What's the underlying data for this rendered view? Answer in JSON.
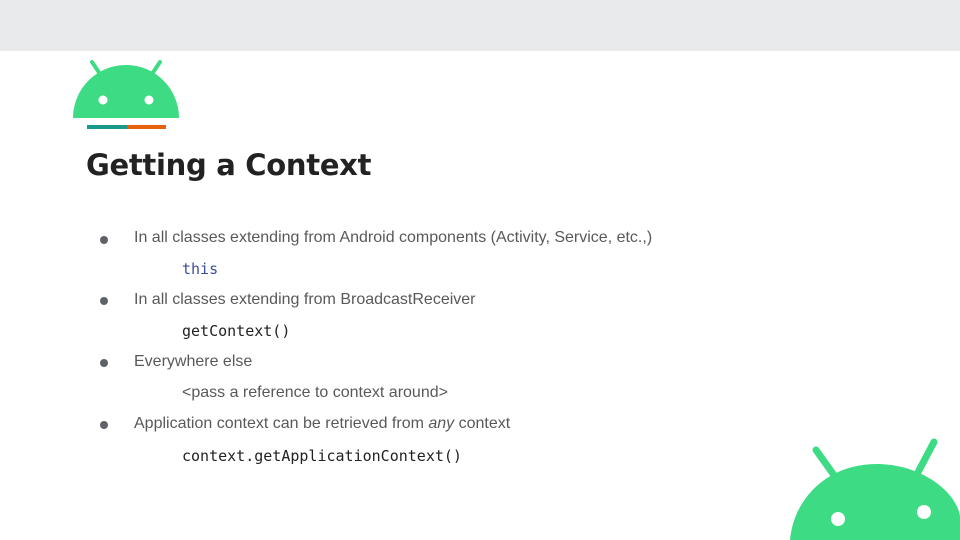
{
  "slide": {
    "title": "Getting a Context",
    "bullets": [
      {
        "text": "In all classes extending from Android components (Activity, Service, etc.,)",
        "sub": "this",
        "sub_style": "keyword"
      },
      {
        "text": "In all classes extending from BroadcastReceiver",
        "sub": "getContext()",
        "sub_style": "code"
      },
      {
        "text": "Everywhere else",
        "sub": "<pass a reference to context around>",
        "sub_style": "plain"
      },
      {
        "text_before": "Application context can be retrieved from ",
        "text_emphasis": "any",
        "text_after": " context",
        "sub": "context.getApplicationContext()",
        "sub_style": "code"
      }
    ]
  },
  "colors": {
    "top_bar": "#e8eaeb",
    "android_green": "#3ddc84",
    "accent_teal": "#1a9a8a",
    "accent_orange": "#e8620c",
    "keyword_blue": "#3c4ea0"
  },
  "icons": {
    "logo": "android-head-icon",
    "corner": "android-head-icon"
  }
}
